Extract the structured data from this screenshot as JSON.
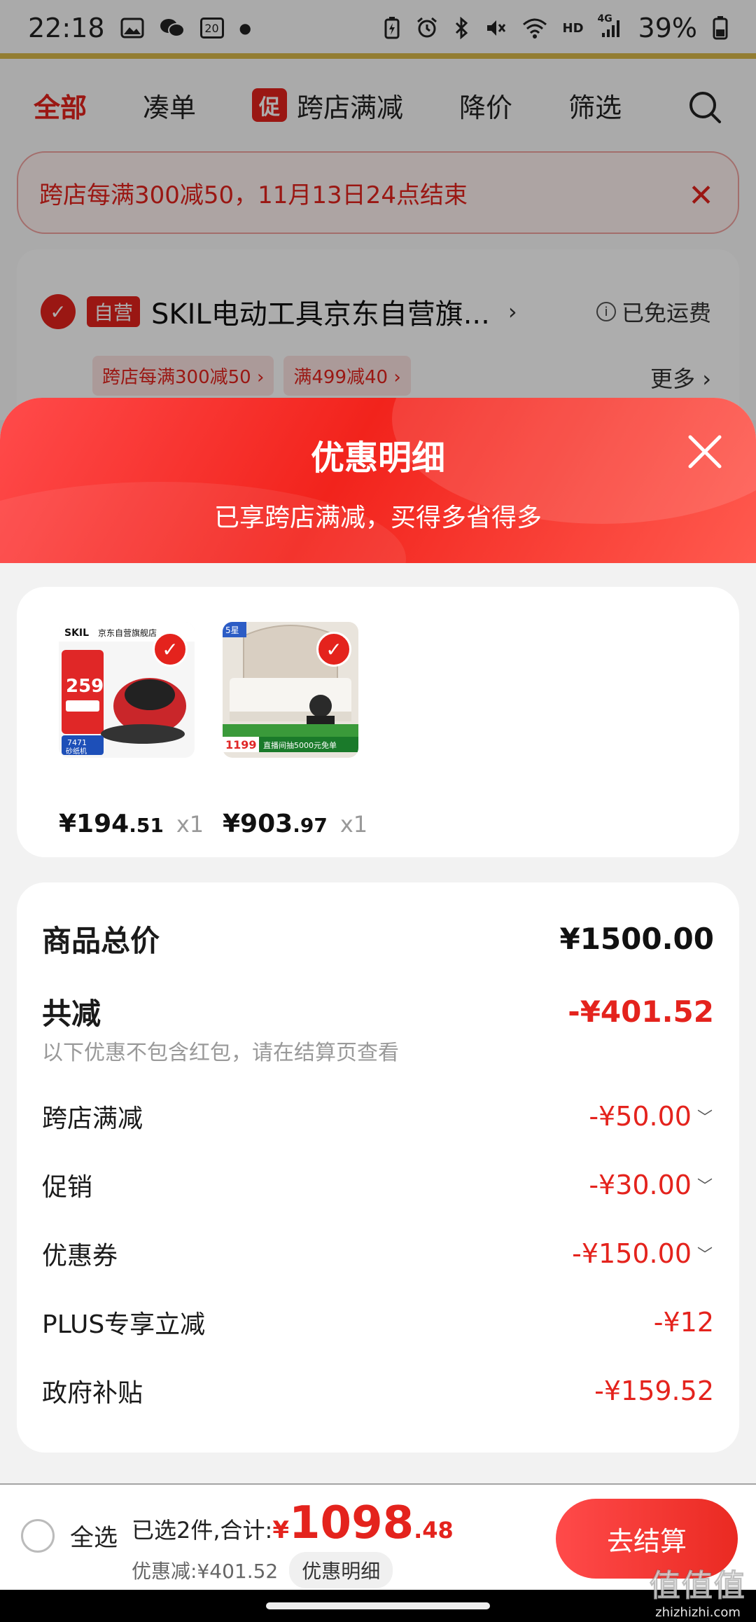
{
  "status_bar": {
    "time": "22:18",
    "calendar_day": "20",
    "network": "4G",
    "hd": "HD",
    "battery": "39%"
  },
  "tabs": [
    {
      "label": "全部",
      "active": true
    },
    {
      "label": "凑单",
      "active": false
    },
    {
      "label": "跨店满减",
      "badge": "促",
      "active": false
    },
    {
      "label": "降价",
      "active": false
    },
    {
      "label": "筛选",
      "active": false
    }
  ],
  "notice": {
    "text": "跨店每满300减50，11月13日24点结束"
  },
  "store": {
    "badge": "自营",
    "name": "SKIL电动工具京东自营旗...",
    "arrow": "›",
    "shipping": "已免运费",
    "tags": [
      "跨店每满300减50 ›",
      "满499减40 ›"
    ],
    "more": "更多 ›"
  },
  "sheet": {
    "title": "优惠明细",
    "subtitle": "已享跨店满减，买得多省得多"
  },
  "goods": [
    {
      "price_int": "¥194",
      "price_dec": ".51",
      "qty": "x1",
      "img": {
        "shop": "京东自营旗舰店",
        "brand": "SKIL",
        "promo_price": "259",
        "model": "7471",
        "tag": "砂纸机"
      }
    },
    {
      "price_int": "¥903",
      "price_dec": ".97",
      "qty": "x1",
      "img": {
        "badge": "5星",
        "price": "1199",
        "banner": "直播间抽5000元免单"
      }
    }
  ],
  "summary": {
    "total_label": "商品总价",
    "total_value": "¥1500.00",
    "reduce_label": "共减",
    "reduce_value": "-¥401.52",
    "note": "以下优惠不包含红包，请在结算页查看",
    "items": [
      {
        "label": "跨店满减",
        "value": "-¥50.00",
        "chevron": "﹀"
      },
      {
        "label": "促销",
        "value": "-¥30.00",
        "chevron": "﹀"
      },
      {
        "label": "优惠券",
        "value": "-¥150.00",
        "chevron": "﹀"
      },
      {
        "label": "PLUS专享立减",
        "value": "-¥12",
        "chevron": ""
      },
      {
        "label": "政府补贴",
        "value": "-¥159.52",
        "chevron": ""
      }
    ]
  },
  "bottom": {
    "select_all": "全选",
    "selected_text": "已选2件,合计:",
    "yen": "¥",
    "sum_int": "1098",
    "sum_dec": ".48",
    "discount_text": "优惠减:¥401.52",
    "detail_btn": "优惠明细",
    "checkout": "去结算"
  },
  "watermark": {
    "logo": "值值值",
    "site": "zhizhizhi.com"
  },
  "colors": {
    "accent_red": "#e4231d",
    "header_gradient_start": "#ff4b4b",
    "header_gradient_end": "#ff5a4f"
  }
}
